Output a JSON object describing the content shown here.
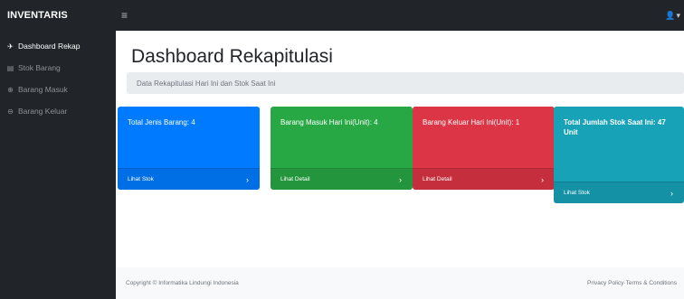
{
  "topbar": {
    "brand": "INVENTARIS",
    "menu_icon": "hamburger-icon",
    "user_icon": "user-icon",
    "user_caret": "▾"
  },
  "sidebar": {
    "items": [
      {
        "label": "Dashboard Rekap",
        "icon": "dashboard-icon",
        "active": true
      },
      {
        "label": "Stok Barang",
        "icon": "table-icon",
        "active": false
      },
      {
        "label": "Barang Masuk",
        "icon": "circle-plus-icon",
        "active": false
      },
      {
        "label": "Barang Keluar",
        "icon": "circle-minus-icon",
        "active": false
      }
    ]
  },
  "main": {
    "title": "Dashboard Rekapitulasi",
    "breadcrumb": "Data Rekapitulasi Hari Ini dan Stok Saat Ini",
    "cards": [
      {
        "text": "Total Jenis Barang: 4",
        "link": "Lihat Stok",
        "color": "#007bff"
      },
      {
        "text": "Barang Masuk Hari Ini(Unit): 4",
        "link": "Lihat Detail",
        "color": "#28a745"
      },
      {
        "text": "Barang Keluar Hari Ini(Unit): 1",
        "link": "Lihat Detail",
        "color": "#dc3545"
      },
      {
        "text": "Total Jumlah Stok Saat Ini: 47 Unit",
        "link": "Lihat Stok",
        "color": "#17a2b8"
      }
    ]
  },
  "footer": {
    "copyright": "Copyright © Informatika Lindungi Indonesia",
    "privacy": "Privacy Policy",
    "separator": " · ",
    "terms": "Terms & Conditions"
  }
}
